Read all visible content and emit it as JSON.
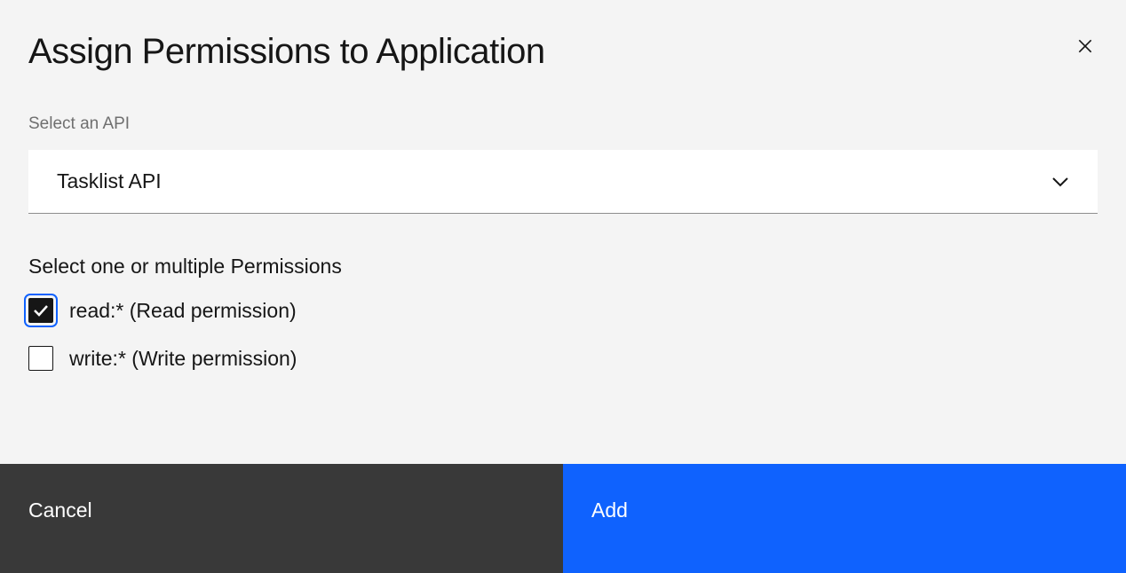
{
  "modal": {
    "title": "Assign Permissions to Application",
    "apiSelect": {
      "label": "Select an API",
      "selected": "Tasklist API"
    },
    "permissions": {
      "label": "Select one or multiple Permissions",
      "items": [
        {
          "label": "read:* (Read permission)",
          "checked": true
        },
        {
          "label": "write:* (Write permission)",
          "checked": false
        }
      ]
    },
    "buttons": {
      "cancel": "Cancel",
      "add": "Add"
    }
  }
}
